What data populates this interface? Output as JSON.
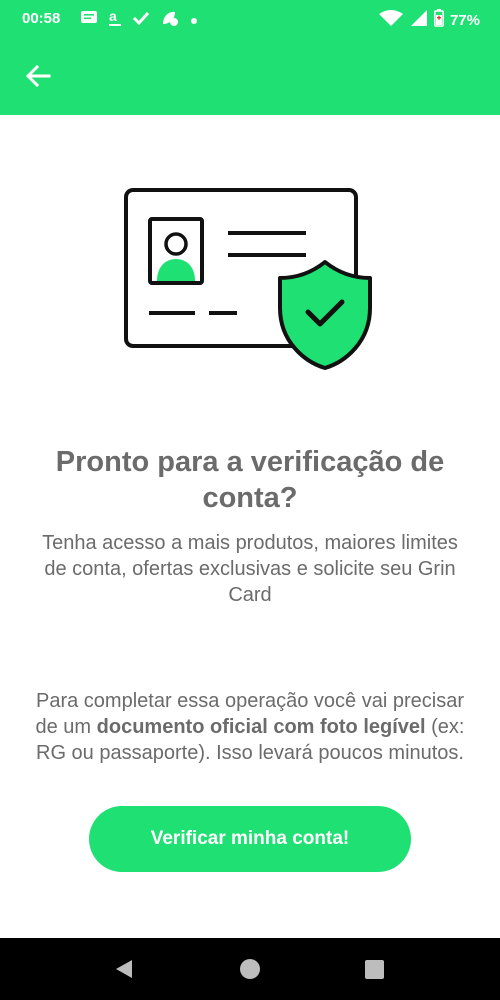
{
  "status_bar": {
    "time": "00:58",
    "battery": "77%",
    "icons": [
      "message-icon",
      "amazon-icon",
      "check-icon",
      "leaf-icon",
      "dot-icon",
      "wifi-icon",
      "signal-icon",
      "battery-icon"
    ]
  },
  "app_bar": {
    "back_icon": "arrow-left-icon"
  },
  "content": {
    "title": "Pronto para a verificação de conta?",
    "subtitle": "Tenha acesso a mais produtos, maiores limites de conta, ofertas exclusivas e solicite seu Grin Card",
    "info_part1": "Para completar essa operação você vai precisar de um ",
    "info_bold1": "documento oficial com foto legível",
    "info_part2": " (ex: RG ou passaporte). Isso levará poucos minutos.",
    "button_label": "Verificar minha conta!"
  },
  "colors": {
    "brand_green": "#1fe073",
    "text_gray": "#6b6b6b"
  }
}
